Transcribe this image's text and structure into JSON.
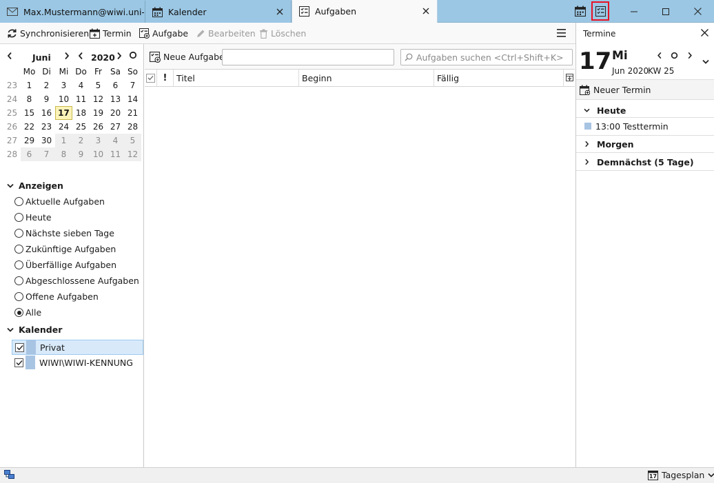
{
  "tabs": [
    {
      "label": "Max.Mustermann@wiwi.uni-m",
      "icon": "mail-icon"
    },
    {
      "label": "Kalender",
      "icon": "calendar-icon"
    },
    {
      "label": "Aufgaben",
      "icon": "tasks-icon"
    }
  ],
  "toolbar": {
    "sync": "Synchronisieren",
    "event": "Termin",
    "task": "Aufgabe",
    "edit": "Bearbeiten",
    "delete": "Löschen"
  },
  "minical": {
    "month": "Juni",
    "year": "2020",
    "weekdays": [
      "Mo",
      "Di",
      "Mi",
      "Do",
      "Fr",
      "Sa",
      "So"
    ],
    "weeks": [
      {
        "wk": "23",
        "days": [
          "1",
          "2",
          "3",
          "4",
          "5",
          "6",
          "7"
        ]
      },
      {
        "wk": "24",
        "days": [
          "8",
          "9",
          "10",
          "11",
          "12",
          "13",
          "14"
        ]
      },
      {
        "wk": "25",
        "days": [
          "15",
          "16",
          "17",
          "18",
          "19",
          "20",
          "21"
        ]
      },
      {
        "wk": "26",
        "days": [
          "22",
          "23",
          "24",
          "25",
          "26",
          "27",
          "28"
        ]
      },
      {
        "wk": "27",
        "days": [
          "29",
          "30",
          "1",
          "2",
          "3",
          "4",
          "5"
        ]
      },
      {
        "wk": "28",
        "days": [
          "6",
          "7",
          "8",
          "9",
          "10",
          "11",
          "12"
        ]
      }
    ],
    "today": "17"
  },
  "filter": {
    "title": "Anzeigen",
    "options": [
      "Aktuelle Aufgaben",
      "Heute",
      "Nächste sieben Tage",
      "Zukünftige Aufgaben",
      "Überfällige Aufgaben",
      "Abgeschlossene Aufgaben",
      "Offene Aufgaben",
      "Alle"
    ],
    "selected": "Alle"
  },
  "calendars": {
    "title": "Kalender",
    "items": [
      {
        "name": "Privat",
        "color": "#a8c4e3"
      },
      {
        "name": "WIWI\\WIWI-KENNUNG",
        "color": "#a8c4e3"
      }
    ]
  },
  "tasks": {
    "new_button": "Neue Aufgabe",
    "quick_add_value": "",
    "search_placeholder": "Aufgaben suchen <Ctrl+Shift+K>",
    "columns": {
      "priority": "!",
      "title": "Titel",
      "start": "Beginn",
      "due": "Fällig"
    }
  },
  "today_pane": {
    "title": "Termine",
    "day": "17",
    "weekday": "Mi",
    "month_year": "Jun 2020",
    "week": "KW 25",
    "new_event": "Neuer Termin",
    "groups": {
      "today": "Heute",
      "tomorrow": "Morgen",
      "soon": "Demnächst (5 Tage)"
    },
    "events": [
      {
        "time_title": "13:00 Testtermin",
        "color": "#a8c4e3"
      }
    ]
  },
  "statusbar": {
    "view_label": "Tagesplan",
    "view_icon_day": "17"
  },
  "colors": {
    "titlebar": "#9bc7e4",
    "highlight": "#e81123",
    "selection": "#d8eafa"
  }
}
